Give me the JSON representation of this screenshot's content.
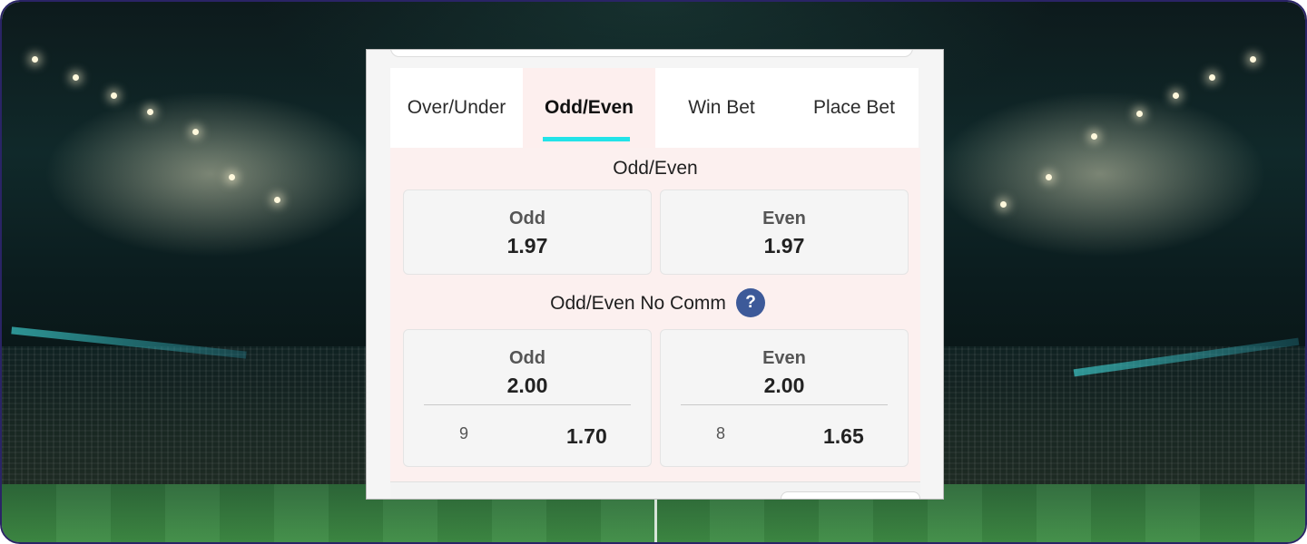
{
  "tabs": [
    {
      "label": "Over/Under",
      "active": false
    },
    {
      "label": "Odd/Even",
      "active": true
    },
    {
      "label": "Win Bet",
      "active": false
    },
    {
      "label": "Place Bet",
      "active": false
    }
  ],
  "accent_color": "#22e3e8",
  "market_odd_even": {
    "title": "Odd/Even",
    "options": [
      {
        "label": "Odd",
        "odds": "1.97"
      },
      {
        "label": "Even",
        "odds": "1.97"
      }
    ]
  },
  "market_no_comm": {
    "title": "Odd/Even No Comm",
    "help_icon": "?",
    "options": [
      {
        "label": "Odd",
        "odds": "2.00",
        "count": "9",
        "price": "1.70"
      },
      {
        "label": "Even",
        "odds": "2.00",
        "count": "8",
        "price": "1.65"
      }
    ]
  }
}
